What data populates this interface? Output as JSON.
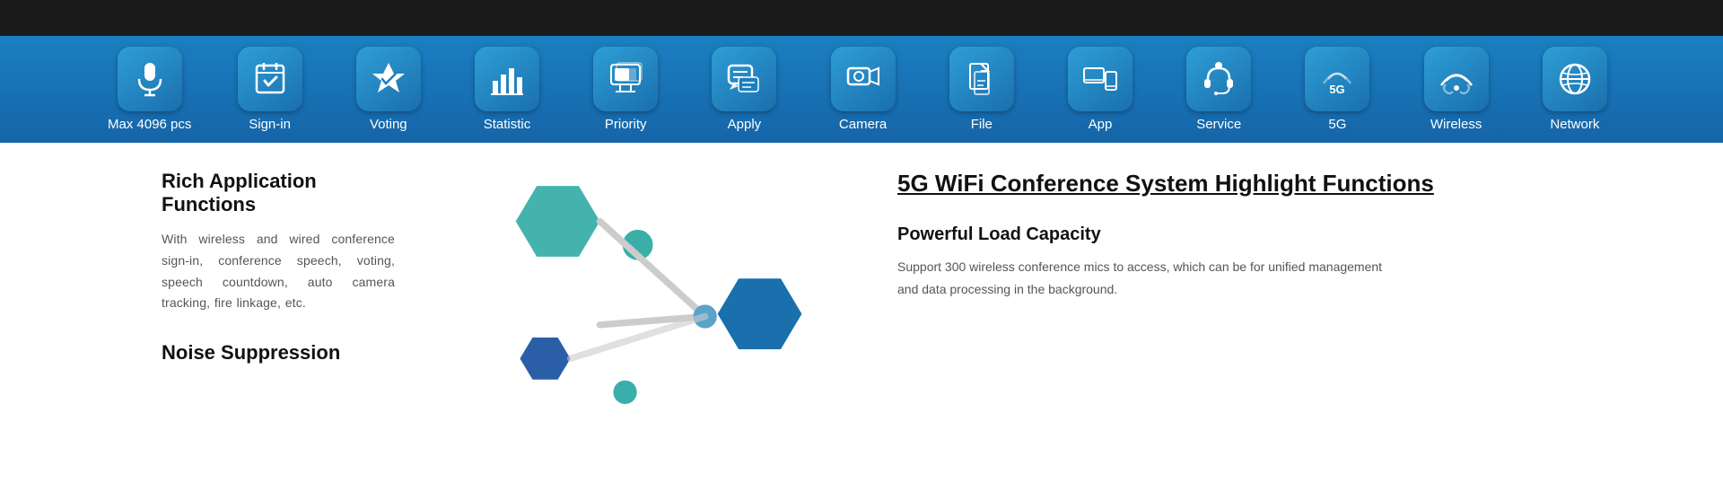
{
  "topBar": {
    "background": "#1a1a1a"
  },
  "iconBar": {
    "items": [
      {
        "id": "max4096",
        "label": "Max 4096 pcs",
        "icon": "mic"
      },
      {
        "id": "signin",
        "label": "Sign-in",
        "icon": "signin"
      },
      {
        "id": "voting",
        "label": "Voting",
        "icon": "voting"
      },
      {
        "id": "statistic",
        "label": "Statistic",
        "icon": "statistic"
      },
      {
        "id": "priority",
        "label": "Priority",
        "icon": "priority"
      },
      {
        "id": "apply",
        "label": "Apply",
        "icon": "apply"
      },
      {
        "id": "camera",
        "label": "Camera",
        "icon": "camera"
      },
      {
        "id": "file",
        "label": "File",
        "icon": "file"
      },
      {
        "id": "app",
        "label": "App",
        "icon": "app"
      },
      {
        "id": "service",
        "label": "Service",
        "icon": "service"
      },
      {
        "id": "5g",
        "label": "5G",
        "icon": "5g"
      },
      {
        "id": "wireless",
        "label": "Wireless",
        "icon": "wireless"
      },
      {
        "id": "network",
        "label": "Network",
        "icon": "network"
      }
    ]
  },
  "leftSection": {
    "richTitle": "Rich Application Functions",
    "richBody": "With wireless and wired conference sign-in, conference speech, voting, speech countdown, auto camera tracking, fire linkage, etc.",
    "noiseTitle": "Noise Suppression"
  },
  "rightSection": {
    "highlightTitle": "5G WiFi Conference System  Highlight Functions",
    "powerTitle": "Powerful Load Capacity",
    "powerBody": "Support 300 wireless conference mics to access, which can be  for unified management and data processing in the background."
  }
}
